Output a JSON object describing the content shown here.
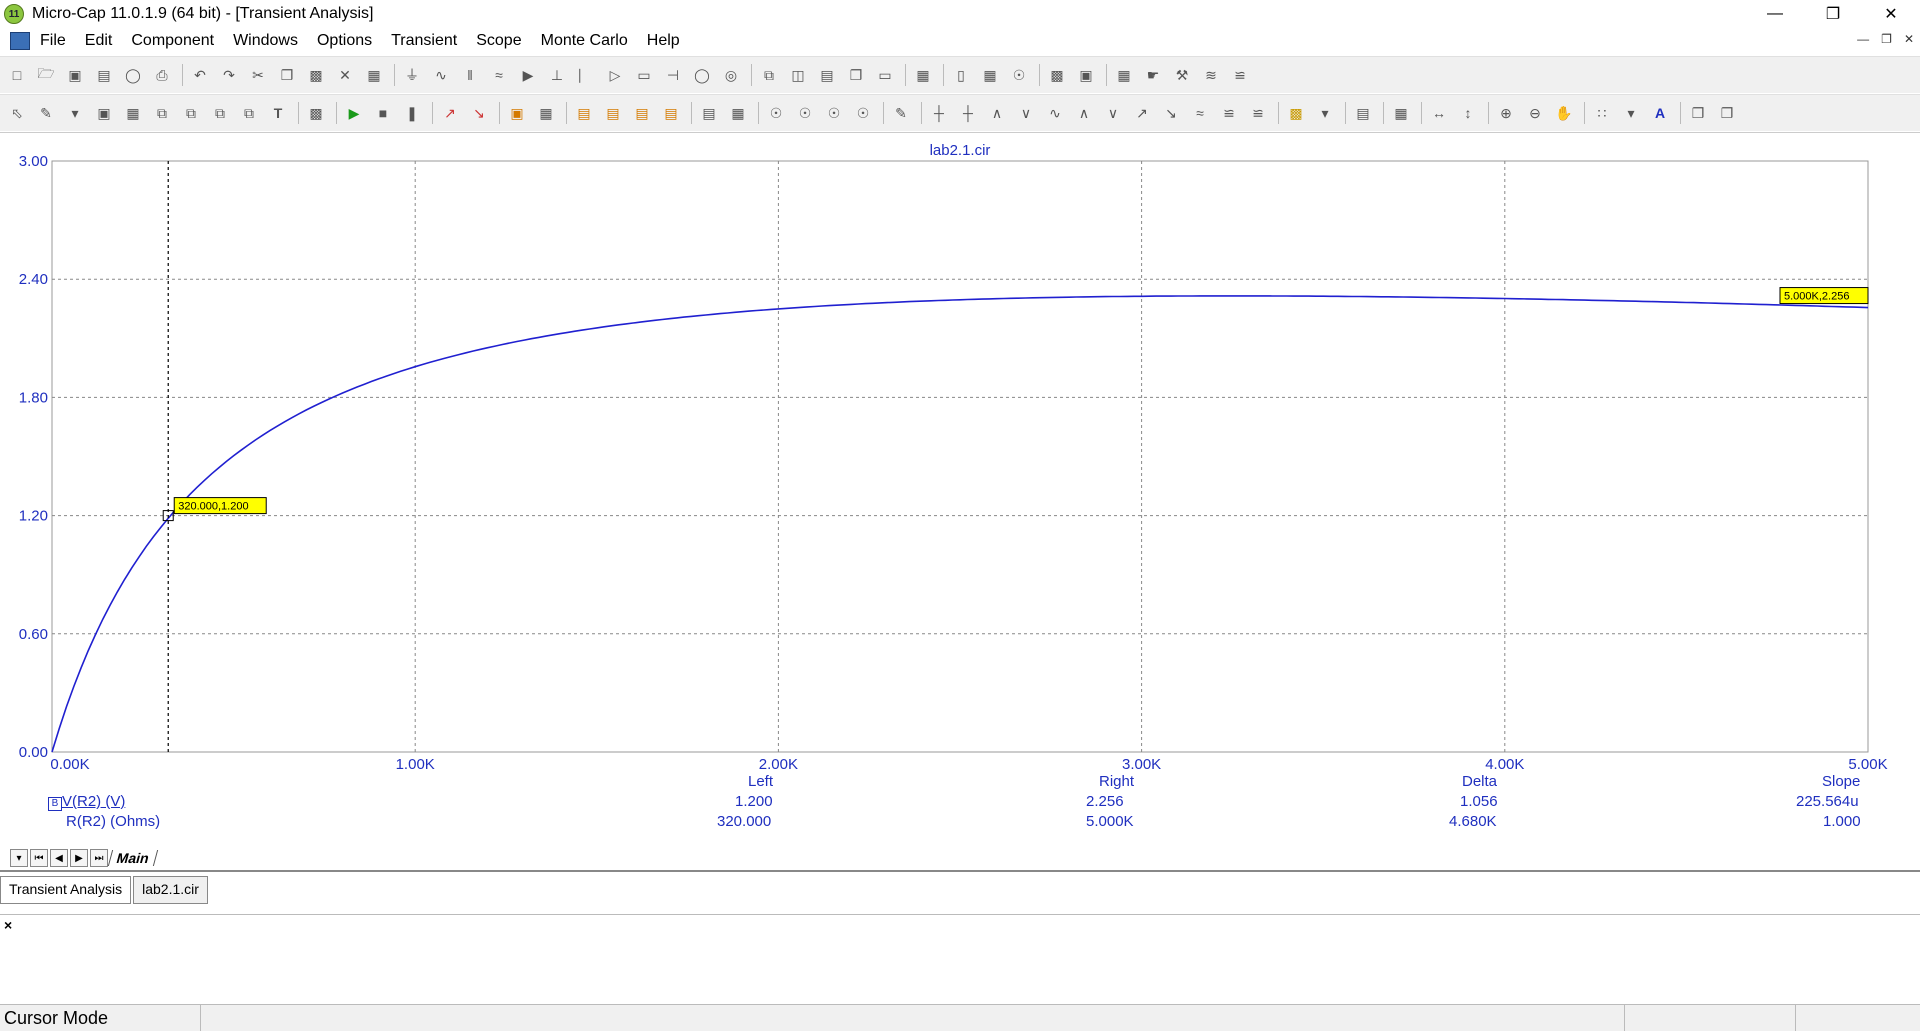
{
  "window": {
    "title": "Micro-Cap 11.0.1.9 (64 bit) - [Transient Analysis]",
    "app_icon_label": "11"
  },
  "menu": [
    "File",
    "Edit",
    "Component",
    "Windows",
    "Options",
    "Transient",
    "Scope",
    "Monte Carlo",
    "Help"
  ],
  "plot": {
    "title": "lab2.1.cir",
    "y_ticks": [
      "3.00",
      "2.40",
      "1.80",
      "1.20",
      "0.60",
      "0.00"
    ],
    "x_ticks": [
      "0.00K",
      "1.00K",
      "2.00K",
      "3.00K",
      "4.00K",
      "5.00K"
    ]
  },
  "chart_data": {
    "type": "line",
    "title": "lab2.1.cir",
    "xlabel": "R(R2) (Ohms)",
    "ylabel": "V(R2) (V)",
    "xlim": [
      0,
      5000
    ],
    "ylim": [
      0,
      3.0
    ],
    "grid": true,
    "line_color": "#2020d0",
    "series": [
      {
        "name": "V(R2) (V)",
        "x": [
          0,
          100,
          200,
          320,
          500,
          750,
          1000,
          1500,
          2000,
          2500,
          3000,
          3500,
          4000,
          4500,
          5000
        ],
        "y": [
          0,
          0.497,
          0.849,
          1.2,
          1.5,
          1.69,
          1.82,
          1.98,
          2.07,
          2.13,
          2.17,
          2.2,
          2.22,
          2.24,
          2.256
        ]
      }
    ],
    "annotations": [
      "320.000,1.200",
      "5.000K,2.256"
    ]
  },
  "readouts": {
    "headers": {
      "left": "Left",
      "right": "Right",
      "delta": "Delta",
      "slope": "Slope"
    },
    "rows": [
      {
        "name": "V(R2) (V)",
        "left": "1.200",
        "right": "2.256",
        "delta": "1.056",
        "slope": "225.564u"
      },
      {
        "name": "R(R2) (Ohms)",
        "left": "320.000",
        "right": "5.000K",
        "delta": "4.680K",
        "slope": "1.000"
      }
    ]
  },
  "sheet_tab": "Main",
  "doc_tabs": [
    "Transient Analysis",
    "lab2.1.cir"
  ],
  "output_close": "×",
  "status": {
    "mode": "Cursor Mode"
  }
}
